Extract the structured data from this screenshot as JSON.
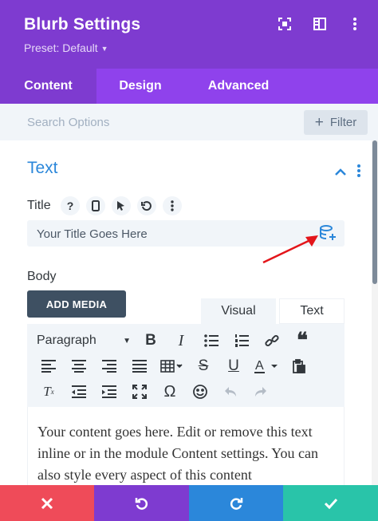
{
  "header": {
    "title": "Blurb Settings",
    "preset": "Preset: Default",
    "bg_color": "#7e3bd0"
  },
  "tabs": [
    {
      "label": "Content",
      "active": true
    },
    {
      "label": "Design",
      "active": false
    },
    {
      "label": "Advanced",
      "active": false
    }
  ],
  "search": {
    "placeholder": "Search Options",
    "filter_label": "Filter"
  },
  "section": {
    "title": "Text"
  },
  "title_field": {
    "label": "Title",
    "value": "Your Title Goes Here",
    "tools": [
      "help-icon",
      "mobile-icon",
      "cursor-icon",
      "reset-icon",
      "more-icon"
    ]
  },
  "body_field": {
    "label": "Body",
    "add_media_label": "ADD MEDIA",
    "editor_tabs": [
      {
        "label": "Visual",
        "active": true
      },
      {
        "label": "Text",
        "active": false
      }
    ],
    "format_select": "Paragraph",
    "content": "Your content goes here. Edit or remove this text inline or in the module Content settings. You can also style every aspect of this content"
  },
  "bottom_bar": {
    "cancel_color": "#ef4b59",
    "undo_color": "#7e3bd0",
    "redo_color": "#2b87da",
    "save_color": "#29c4a9"
  },
  "accent_color": "#2b87da"
}
